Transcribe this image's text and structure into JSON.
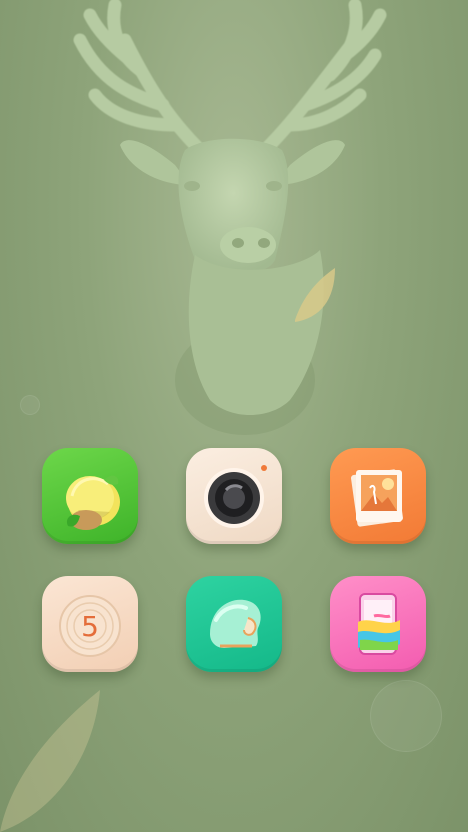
{
  "screen": {
    "wallpaper": "deer-head-wallpaper",
    "accent": "#8ea47a"
  },
  "home_icons": [
    {
      "name": "lemon-app-icon",
      "color": "#4cc232"
    },
    {
      "name": "camera-app-icon",
      "color": "#f3e1cf"
    },
    {
      "name": "photo-gallery-app-icon",
      "color": "#f5843c"
    },
    {
      "name": "wood-clock-app-icon",
      "color": "#f4d6bf",
      "glyph": "5"
    },
    {
      "name": "helmet-app-icon",
      "color": "#1fc294"
    },
    {
      "name": "theme-app-icon",
      "color": "#f66bb7"
    }
  ]
}
